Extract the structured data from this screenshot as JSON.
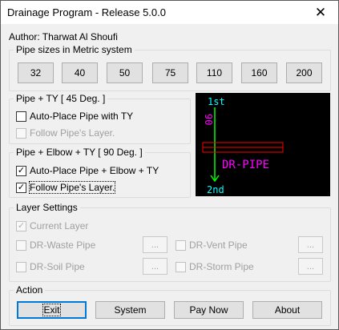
{
  "window": {
    "title": "Drainage Program - Release 5.0.0"
  },
  "author": "Author: Tharwat Al Shoufi",
  "pipe_sizes": {
    "label": "Pipe sizes in Metric system",
    "buttons": [
      "32",
      "40",
      "50",
      "75",
      "110",
      "160",
      "200"
    ]
  },
  "ty_group": {
    "label": "Pipe + TY [ 45 Deg. ]",
    "auto_place": {
      "label": "Auto-Place Pipe with TY",
      "checked": false
    },
    "follow_layer": {
      "label": "Follow Pipe's Layer.",
      "checked": false,
      "enabled": false
    }
  },
  "elbow_group": {
    "label": "Pipe + Elbow + TY [ 90 Deg. ]",
    "auto_place": {
      "label": "Auto-Place Pipe + Elbow + TY",
      "checked": true
    },
    "follow_layer": {
      "label": "Follow Pipe's Layer.",
      "checked": true,
      "enabled": true
    }
  },
  "preview": {
    "label_top": "1st",
    "label_bottom": "2nd",
    "label_rotated": "90",
    "pipe_label": "DR-PIPE",
    "colors": {
      "green": "#00ff00",
      "magenta": "#ff00ff",
      "red": "#ff0000",
      "background": "#000000"
    }
  },
  "layer_settings": {
    "label": "Layer Settings",
    "current_layer": {
      "label": "Current Layer",
      "checked": true
    },
    "waste_pipe": {
      "label": "DR-Waste Pipe",
      "button": "..."
    },
    "vent_pipe": {
      "label": "DR-Vent Pipe",
      "button": "..."
    },
    "soil_pipe": {
      "label": "DR-Soil Pipe",
      "button": "..."
    },
    "storm_pipe": {
      "label": "DR-Storm Pipe",
      "button": "..."
    }
  },
  "action": {
    "label": "Action",
    "buttons": {
      "exit": "Exit",
      "system": "System",
      "pay_now": "Pay Now",
      "about": "About"
    }
  },
  "icons": {
    "close": "close-icon",
    "check": "check-icon"
  }
}
